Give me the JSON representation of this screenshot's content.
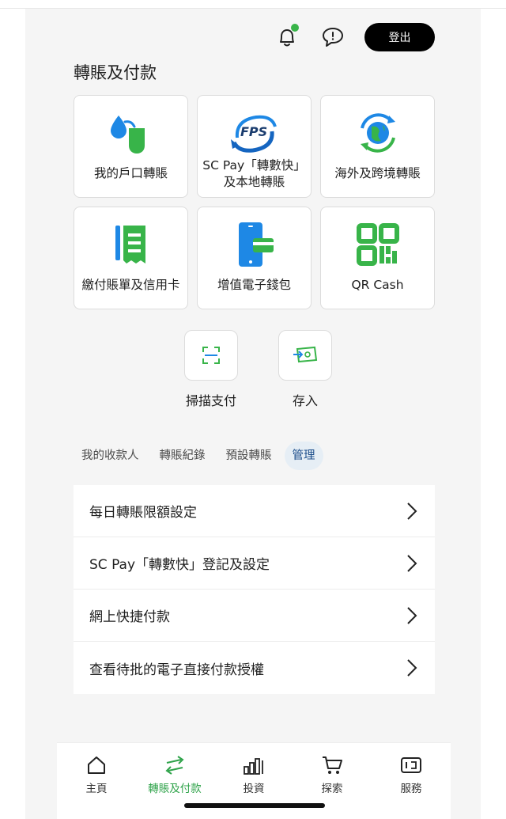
{
  "header": {
    "logout_label": "登出",
    "bell_icon": "bell-icon",
    "chat_icon": "chat-icon",
    "notification_dot_color": "#38b449"
  },
  "section_title": "轉賬及付款",
  "tiles": [
    {
      "label": "我的戶口轉賬",
      "icon": "own-account-transfer-icon"
    },
    {
      "label": "SC Pay「轉數快」及本地轉賬",
      "line1": "SC Pay「轉數快」",
      "line2": "及本地轉賬",
      "icon": "fps-icon",
      "icon_text": "FPS"
    },
    {
      "label": "海外及跨境轉賬",
      "icon": "overseas-transfer-icon"
    },
    {
      "label": "繳付賬單及信用卡",
      "icon": "bill-payment-icon"
    },
    {
      "label": "增值電子錢包",
      "icon": "e-wallet-topup-icon"
    },
    {
      "label": "QR Cash",
      "icon": "qr-code-icon"
    }
  ],
  "quick_actions": [
    {
      "label": "掃描支付",
      "icon": "scan-icon"
    },
    {
      "label": "存入",
      "icon": "deposit-icon"
    }
  ],
  "tabs": [
    {
      "label": "我的收款人",
      "active": false
    },
    {
      "label": "轉賬紀錄",
      "active": false
    },
    {
      "label": "預設轉賬",
      "active": false
    },
    {
      "label": "管理",
      "active": true
    }
  ],
  "manage_items": [
    {
      "label": "每日轉賬限額設定"
    },
    {
      "label": "SC Pay「轉數快」登記及設定"
    },
    {
      "label": "網上快捷付款"
    },
    {
      "label": "查看待批的電子直接付款授權"
    }
  ],
  "bottom_nav": [
    {
      "label": "主頁",
      "icon": "home-icon",
      "active": false
    },
    {
      "label": "轉賬及付款",
      "icon": "transfer-icon",
      "active": true
    },
    {
      "label": "投資",
      "icon": "invest-chart-icon",
      "active": false
    },
    {
      "label": "探索",
      "icon": "cart-icon",
      "active": false
    },
    {
      "label": "服務",
      "icon": "wallet-service-icon",
      "active": false
    }
  ],
  "colors": {
    "brand_green": "#38b449",
    "brand_blue": "#1e88e5",
    "active_tab_bg": "#e6eef5",
    "active_tab_text": "#1d4f8c"
  }
}
